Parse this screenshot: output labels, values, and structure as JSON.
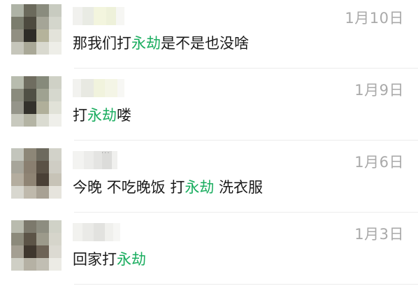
{
  "highlight_color": "#1aad5f",
  "rows": [
    {
      "date": "1月10日",
      "message": {
        "a": "那我们打",
        "hl": "永劫",
        "b": "是不是也没啥"
      },
      "avatar_colors": [
        "#aeb3a6",
        "#6b6a5c",
        "#8a8c7e",
        "#c8cbc0",
        "#7b7d6e",
        "#4d4a3f",
        "#a5a597",
        "#d4d6cc",
        "#918f82",
        "#2e2c27",
        "#b5b39b",
        "#e3e3da",
        "#c6c6bb",
        "#a9a897",
        "#d9d9cf",
        "#eeeee8"
      ],
      "name_colors": [
        "#f1f1ee",
        "#e9ebe4",
        "#f3f5de",
        "#eef1da",
        "#f6f6f3"
      ]
    },
    {
      "date": "1月9日",
      "message": {
        "a": "打",
        "hl": "永劫",
        "b": "喽"
      },
      "avatar_colors": [
        "#b8bcae",
        "#6f6d60",
        "#868a7b",
        "#cfd1c6",
        "#8a8b7d",
        "#505045",
        "#9fa291",
        "#d6d8ce",
        "#95958a",
        "#33312b",
        "#b0af9a",
        "#e1e2d8",
        "#c8c9be",
        "#b4b4a4",
        "#dadbd1",
        "#efefea"
      ],
      "name_colors": [
        "#f2f2ef",
        "#e8e9e2",
        "#f1f3dd",
        "#f4f5e6",
        "#f7f7f4"
      ]
    },
    {
      "date": "1月6日",
      "message": {
        "a": "今晚 不吃晚饭 打",
        "hl": "永劫",
        "b": " 洗衣服"
      },
      "avatar_colors": [
        "#c3c5bc",
        "#8d8778",
        "#6d6a5e",
        "#d2d2c9",
        "#a7a59a",
        "#8a7f70",
        "#5b5246",
        "#cfcdc4",
        "#b4ad9f",
        "#8f8474",
        "#4a4036",
        "#c7c3b7",
        "#d8d7cf",
        "#bfb9ac",
        "#a8a194",
        "#e6e4dd"
      ],
      "dots": "··· ",
      "name_colors": [
        "#f3f3f1",
        "#ececea",
        "#e4e4e2",
        "#dcdcda",
        "#f0f0ee"
      ]
    },
    {
      "date": "1月3日",
      "message": {
        "a": "回家打",
        "hl": "永劫",
        "b": ""
      },
      "avatar_colors": [
        "#b9bbae",
        "#7c796c",
        "#8d8d80",
        "#d0d2c7",
        "#8c8a7b",
        "#5c5447",
        "#9c9a8b",
        "#d6d5cb",
        "#a49f92",
        "#3f372e",
        "#6d6356",
        "#dcdad2",
        "#cfcfc5",
        "#b5b1a4",
        "#c1beb3",
        "#ecebe5"
      ],
      "name_colors": [
        "#f2f2ef",
        "#eaeae7",
        "#e2e2df",
        "#f0f0ed",
        "#f6f6f4"
      ]
    }
  ]
}
